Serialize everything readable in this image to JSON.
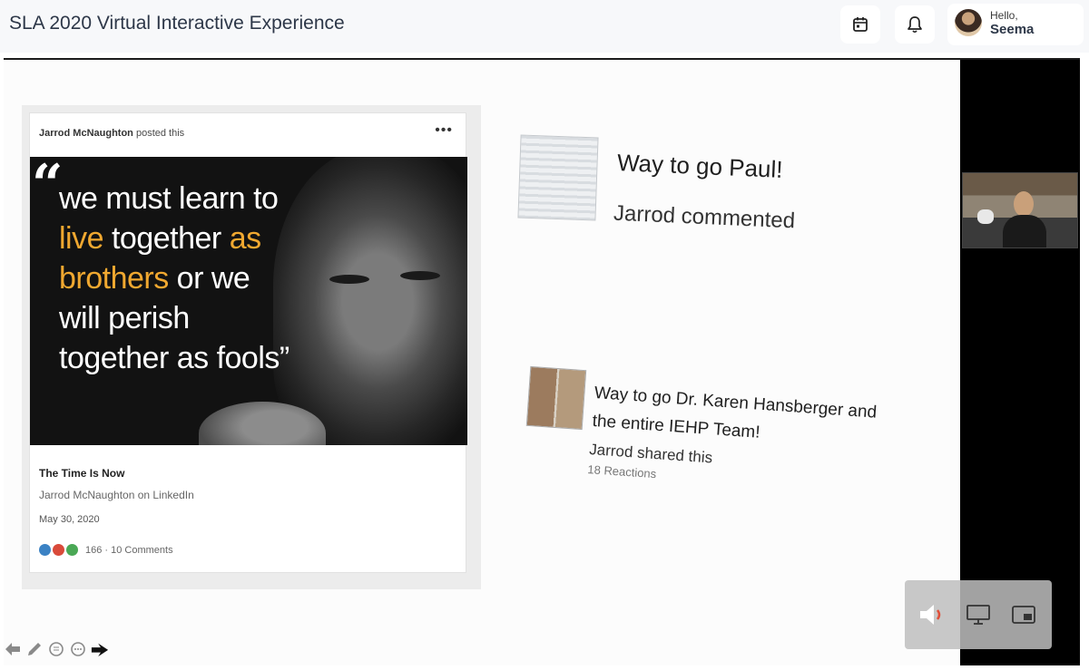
{
  "header": {
    "title": "SLA 2020 Virtual Interactive Experience",
    "greeting": "Hello,",
    "user_name": "Seema",
    "calendar_icon": "calendar-icon",
    "bell_icon": "bell-icon"
  },
  "slide": {
    "post": {
      "author": "Jarrod McNaughton",
      "action": "posted this",
      "menu": "•••",
      "quote_open": "“",
      "quote_part1": "we must learn to ",
      "quote_hl1": "live",
      "quote_part2": " together ",
      "quote_hl2": "as brothers",
      "quote_part3": " or we will perish together as fools”",
      "title": "The Time Is Now",
      "source": "Jarrod McNaughton on LinkedIn",
      "date": "May 30, 2020",
      "reactions": "166 · 10 Comments"
    },
    "comment1": {
      "title": "Way to go Paul!",
      "subtitle": "Jarrod commented"
    },
    "comment2": {
      "title": "Way to go Dr. Karen Hansberger and the entire IEHP Team!",
      "subtitle": "Jarrod shared this",
      "reactions": "18 Reactions"
    }
  },
  "annotation_tools": [
    "arrow-left-icon",
    "pen-icon",
    "circle-icon",
    "more-icon",
    "pointer-icon"
  ],
  "video_controls": [
    "speaker-icon",
    "monitor-icon",
    "picture-in-picture-icon"
  ],
  "colors": {
    "accent_quote": "#f0a830",
    "topbar_bg": "#f7f8fa",
    "stage_bg": "#000000"
  }
}
